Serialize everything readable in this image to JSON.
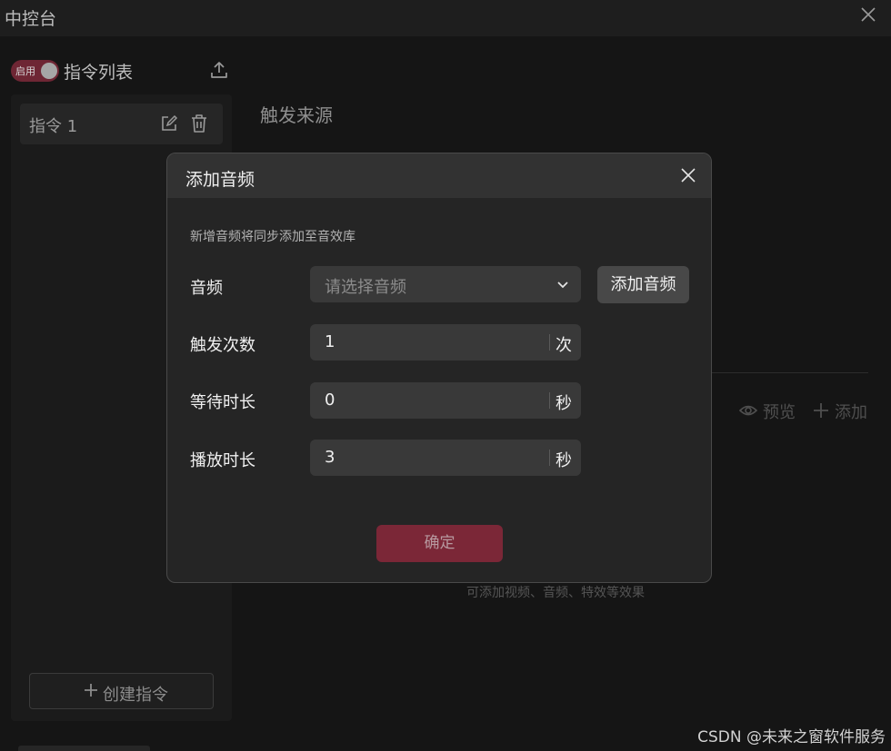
{
  "window": {
    "title": "中控台"
  },
  "list": {
    "toggle_label": "启用",
    "title": "指令列表"
  },
  "commands": [
    {
      "label": "指令 1"
    }
  ],
  "create_button": {
    "label": "创建指令"
  },
  "main": {
    "trigger_title": "触发来源",
    "preview_label": "预览",
    "add_label": "添加",
    "hint": "可添加视频、音频、特效等效果"
  },
  "modal": {
    "title": "添加音频",
    "notice": "新增音频将同步添加至音效库",
    "audio": {
      "label": "音频",
      "placeholder": "请选择音频",
      "add_button": "添加音频"
    },
    "trigger_count": {
      "label": "触发次数",
      "value": "1",
      "unit": "次"
    },
    "wait_duration": {
      "label": "等待时长",
      "value": "0",
      "unit": "秒"
    },
    "play_duration": {
      "label": "播放时长",
      "value": "3",
      "unit": "秒"
    },
    "confirm_button": "确定"
  },
  "watermark": "CSDN @未来之窗软件服务",
  "colors": {
    "accent": "#7b2737",
    "background": "#151515",
    "modal": "#252525"
  }
}
